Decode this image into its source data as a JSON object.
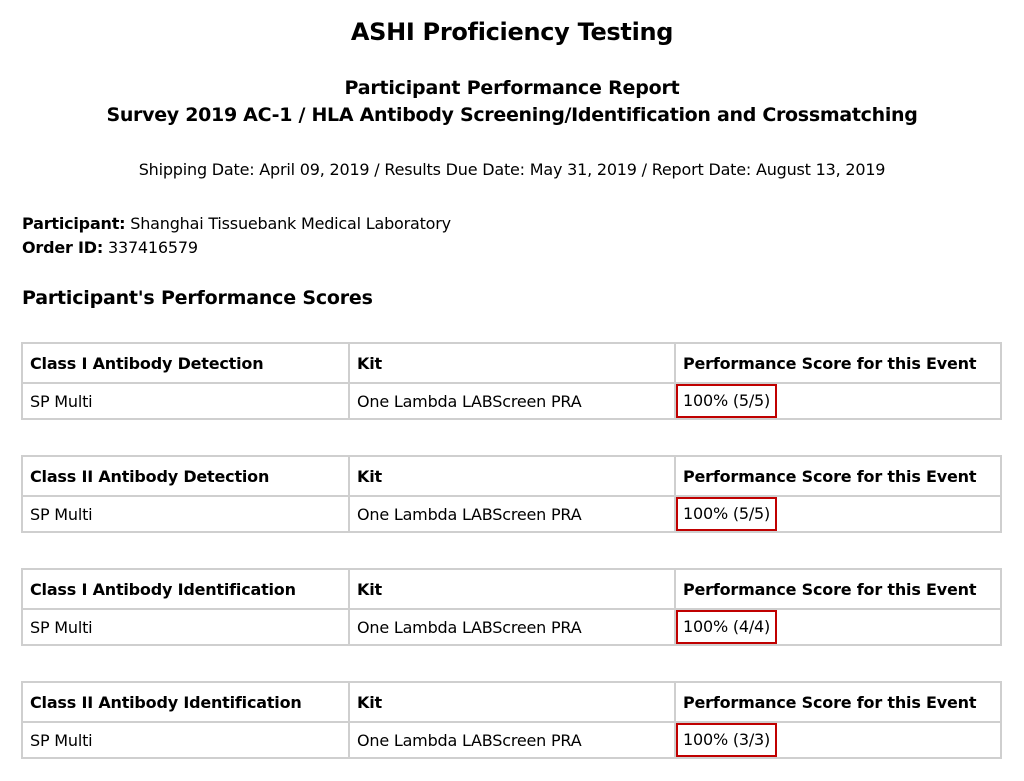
{
  "report": {
    "title": "ASHI Proficiency Testing",
    "subtitle_line1": "Participant Performance Report",
    "subtitle_line2": "Survey 2019 AC-1 / HLA Antibody Screening/Identification and Crossmatching",
    "dates_line": "Shipping Date: April 09, 2019 / Results Due Date: May 31, 2019 / Report Date: August 13, 2019"
  },
  "participant": {
    "label": "Participant:",
    "value": "Shanghai Tissuebank Medical Laboratory"
  },
  "order": {
    "label": "Order ID:",
    "value": "337416579"
  },
  "scores_section": {
    "heading": "Participant's Performance Scores"
  },
  "tables": [
    {
      "headers": [
        "Class I Antibody Detection",
        "Kit",
        "Performance Score for this Event"
      ],
      "row": [
        "SP Multi",
        "One Lambda LABScreen PRA",
        "100% (5/5)"
      ]
    },
    {
      "headers": [
        "Class II Antibody Detection",
        "Kit",
        "Performance Score for this Event"
      ],
      "row": [
        "SP Multi",
        "One Lambda LABScreen PRA",
        "100% (5/5)"
      ]
    },
    {
      "headers": [
        "Class I Antibody Identification",
        "Kit",
        "Performance Score for this Event"
      ],
      "row": [
        "SP Multi",
        "One Lambda LABScreen PRA",
        "100% (4/4)"
      ]
    },
    {
      "headers": [
        "Class II Antibody Identification",
        "Kit",
        "Performance Score for this Event"
      ],
      "row": [
        "SP Multi",
        "One Lambda LABScreen PRA",
        "100% (3/3)"
      ]
    }
  ],
  "colors": {
    "highlight_border": "#c00000",
    "table_border": "#cfcfcf"
  }
}
